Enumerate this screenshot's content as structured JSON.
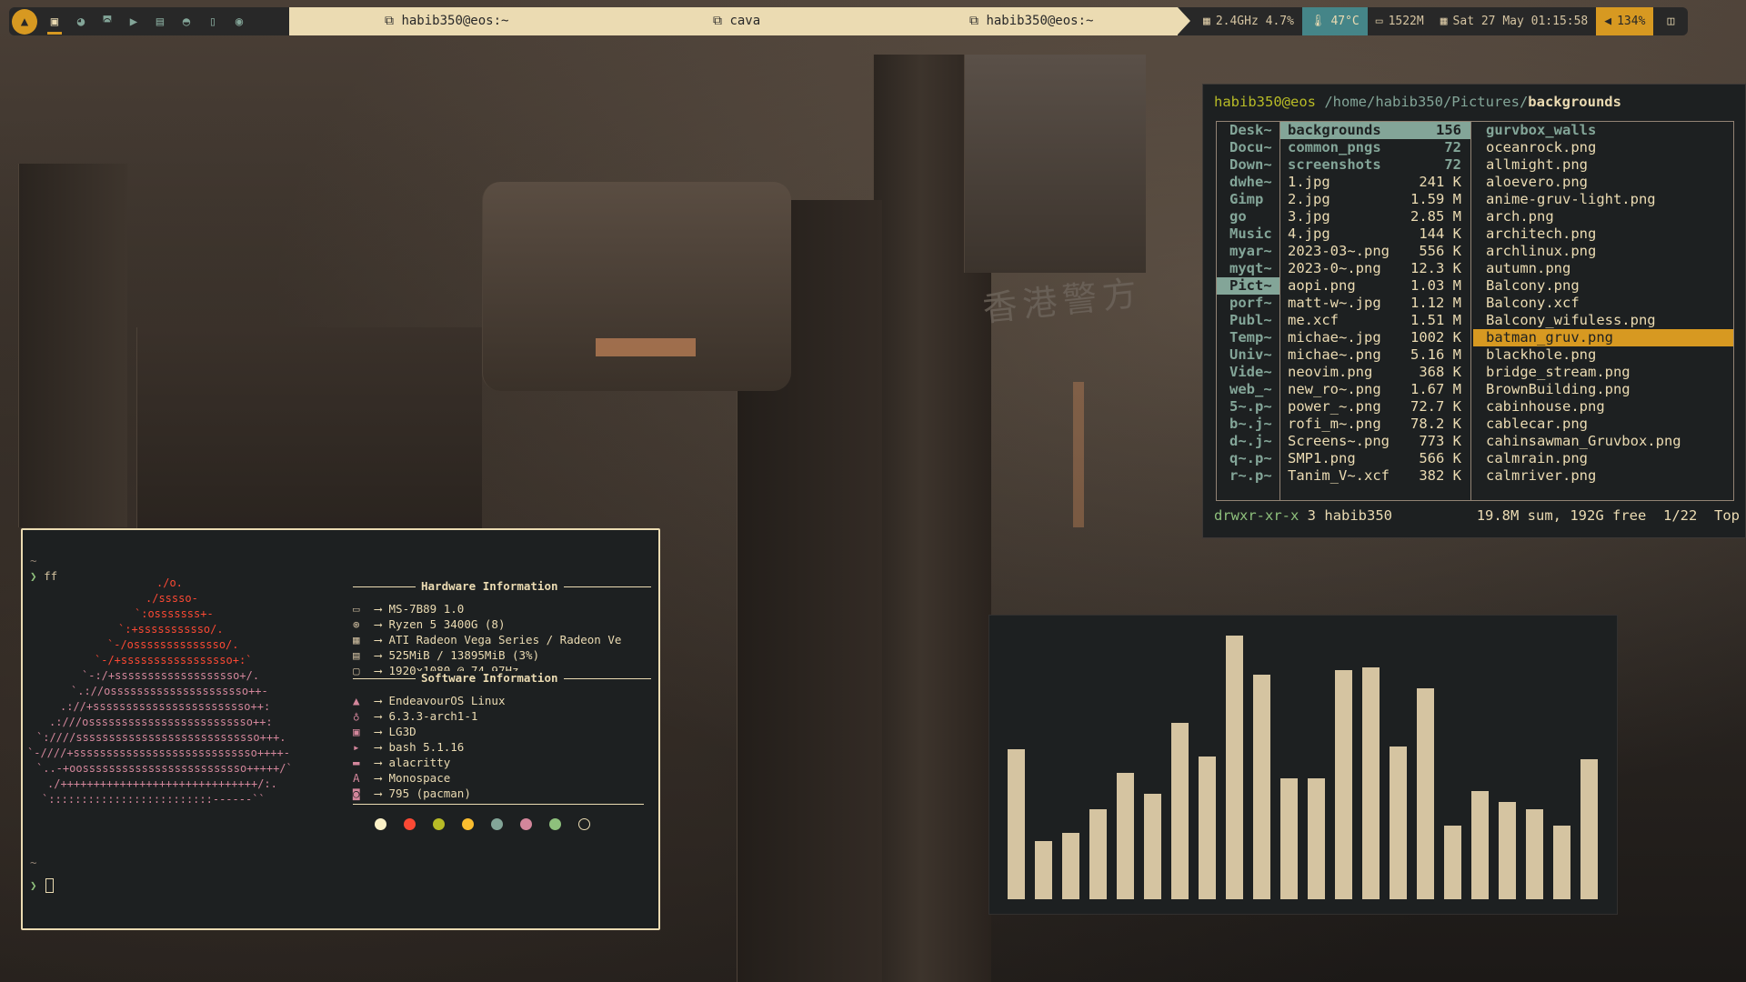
{
  "topbar": {
    "workspace_icons": [
      "launcher-icon",
      "terminal-icon",
      "firefox-icon",
      "discord-icon",
      "youtube-icon",
      "chat-icon",
      "edge-icon",
      "book-icon",
      "steam-icon"
    ],
    "windows": [
      {
        "icon": "⧉",
        "title": "habib350@eos:~"
      },
      {
        "icon": "⧉",
        "title": "cava"
      },
      {
        "icon": "⧉",
        "title": "habib350@eos:~"
      }
    ],
    "cpu": "2.4GHz 4.7%",
    "temp": "47°C",
    "mem": "1522M",
    "date": "Sat 27 May 01:15:58",
    "volume": "134%",
    "colors": {
      "bar_bg": "#282828",
      "bar_light": "#ebdbb2",
      "temp_bg": "#458588",
      "vol_bg": "#d79921"
    }
  },
  "file_manager": {
    "user": "habib350@eos",
    "path": "/home/habib350/Pictures/",
    "current": "backgrounds",
    "parent_entries": [
      "Desk~",
      "Docu~",
      "Down~",
      "dwhe~",
      "Gimp",
      "go",
      "Music",
      "myar~",
      "myqt~",
      "Pict~",
      "porf~",
      "Publ~",
      "Temp~",
      "Univ~",
      "Vide~",
      "web_~",
      "5~.p~",
      "b~.j~",
      "d~.j~",
      "q~.p~",
      "r~.p~"
    ],
    "parent_selected": "Pict~",
    "entries": [
      {
        "name": "backgrounds",
        "size": "156",
        "type": "dir",
        "selected": true
      },
      {
        "name": "common_pngs",
        "size": "72",
        "type": "dir"
      },
      {
        "name": "screenshots",
        "size": "72",
        "type": "dir"
      },
      {
        "name": "1.jpg",
        "size": "241 K",
        "type": "file"
      },
      {
        "name": "2.jpg",
        "size": "1.59 M",
        "type": "file"
      },
      {
        "name": "3.jpg",
        "size": "2.85 M",
        "type": "file"
      },
      {
        "name": "4.jpg",
        "size": "144 K",
        "type": "file"
      },
      {
        "name": "2023-03~.png",
        "size": "556 K",
        "type": "file"
      },
      {
        "name": "2023-0~.png",
        "size": "12.3 K",
        "type": "file"
      },
      {
        "name": "aopi.png",
        "size": "1.03 M",
        "type": "file"
      },
      {
        "name": "matt-w~.jpg",
        "size": "1.12 M",
        "type": "file"
      },
      {
        "name": "me.xcf",
        "size": "1.51 M",
        "type": "file"
      },
      {
        "name": "michae~.jpg",
        "size": "1002 K",
        "type": "file"
      },
      {
        "name": "michae~.png",
        "size": "5.16 M",
        "type": "file"
      },
      {
        "name": "neovim.png",
        "size": "368 K",
        "type": "file"
      },
      {
        "name": "new_ro~.png",
        "size": "1.67 M",
        "type": "file"
      },
      {
        "name": "power_~.png",
        "size": "72.7 K",
        "type": "file"
      },
      {
        "name": "rofi_m~.png",
        "size": "78.2 K",
        "type": "file"
      },
      {
        "name": "Screens~.png",
        "size": "773 K",
        "type": "file"
      },
      {
        "name": "SMP1.png",
        "size": "566 K",
        "type": "file"
      },
      {
        "name": "Tanim_V~.xcf",
        "size": "382 K",
        "type": "file"
      }
    ],
    "preview": [
      {
        "name": "gurvbox_walls",
        "type": "dir"
      },
      {
        "name": " oceanrock.png",
        "type": "file"
      },
      {
        "name": "allmight.png",
        "type": "file"
      },
      {
        "name": "aloevero.png",
        "type": "file"
      },
      {
        "name": "anime-gruv-light.png",
        "type": "file"
      },
      {
        "name": "arch.png",
        "type": "file"
      },
      {
        "name": "architech.png",
        "type": "file"
      },
      {
        "name": "archlinux.png",
        "type": "file"
      },
      {
        "name": "autumn.png",
        "type": "file"
      },
      {
        "name": "Balcony.png",
        "type": "file"
      },
      {
        "name": "Balcony.xcf",
        "type": "file"
      },
      {
        "name": "Balcony_wifuless.png",
        "type": "file"
      },
      {
        "name": "batman_gruv.png",
        "type": "file",
        "selected": true
      },
      {
        "name": "blackhole.png",
        "type": "file"
      },
      {
        "name": "bridge_stream.png",
        "type": "file"
      },
      {
        "name": "BrownBuilding.png",
        "type": "file"
      },
      {
        "name": "cabinhouse.png",
        "type": "file"
      },
      {
        "name": "cablecar.png",
        "type": "file"
      },
      {
        "name": "cahinsawman_Gruvbox.png",
        "type": "file"
      },
      {
        "name": "calmrain.png",
        "type": "file"
      },
      {
        "name": "calmriver.png",
        "type": "file"
      }
    ],
    "status": {
      "perms": "drwxr-xr-x",
      "links": "3",
      "owner": "habib350",
      "summary": "19.8M sum, 192G free",
      "position": "1/22",
      "scroll": "Top"
    }
  },
  "terminal": {
    "tilde": "~",
    "prompt_symbol": "❯",
    "command": "ff",
    "ascii_art": [
      "./o.",
      "./sssso-",
      "`:osssssss+-",
      "`:+sssssssssso/.",
      "`-/ossssssssssssso/.",
      "`-/+sssssssssssssssso+:`",
      "`-:/+sssssssssssssssssso+/.",
      "`.://osssssssssssssssssssso++-",
      ".://+ssssssssssssssssssssssso++:",
      ".:///osssssssssssssssssssssssso++:",
      "`:////ssssssssssssssssssssssssssso+++.",
      "`-////+ssssssssssssssssssssssssssso++++-",
      "`..-+oosssssssssssssssssssssssso+++++/`",
      "./++++++++++++++++++++++++++++++/:.",
      "`:::::::::::::::::::::::::------``"
    ],
    "hardware_header": "Hardware Information",
    "hardware": [
      {
        "icon": "board-icon",
        "glyph": "▭",
        "value": "MS-7B89 1.0"
      },
      {
        "icon": "cpu-icon",
        "glyph": "⊛",
        "value": "Ryzen 5 3400G (8)"
      },
      {
        "icon": "gpu-icon",
        "glyph": "▦",
        "value": "ATI Radeon Vega Series / Radeon Ve"
      },
      {
        "icon": "memory-icon",
        "glyph": "▤",
        "value": "525MiB / 13895MiB (3%)"
      },
      {
        "icon": "monitor-icon",
        "glyph": "▢",
        "value": "1920x1080 @ 74.97Hz"
      }
    ],
    "software_header": "Software Information",
    "software": [
      {
        "icon": "endeavour-icon",
        "glyph": "▲",
        "value": "EndeavourOS Linux"
      },
      {
        "icon": "kernel-icon",
        "glyph": "♁",
        "value": "6.3.3-arch1-1"
      },
      {
        "icon": "display-manager-icon",
        "glyph": "▣",
        "value": "LG3D"
      },
      {
        "icon": "shell-icon",
        "glyph": "▸",
        "value": "bash 5.1.16"
      },
      {
        "icon": "terminal-app-icon",
        "glyph": "▬",
        "value": "alacritty"
      },
      {
        "icon": "font-icon",
        "glyph": "A",
        "value": "Monospace"
      },
      {
        "icon": "package-icon",
        "glyph": "◙",
        "value": "795 (pacman)"
      }
    ],
    "arrow": "⟶",
    "palette": [
      "#fbf1c7",
      "#fb4934",
      "#b8bb26",
      "#fabd2f",
      "#83a598",
      "#d3869b",
      "#8ec07c",
      "#1d2021"
    ]
  },
  "cava": {
    "bar_color": "#d5c4a1",
    "levels": [
      0.57,
      0.22,
      0.25,
      0.34,
      0.48,
      0.4,
      0.67,
      0.54,
      1.0,
      0.85,
      0.46,
      0.46,
      0.87,
      0.88,
      0.58,
      0.8,
      0.28,
      0.41,
      0.37,
      0.34,
      0.28,
      0.53
    ]
  }
}
